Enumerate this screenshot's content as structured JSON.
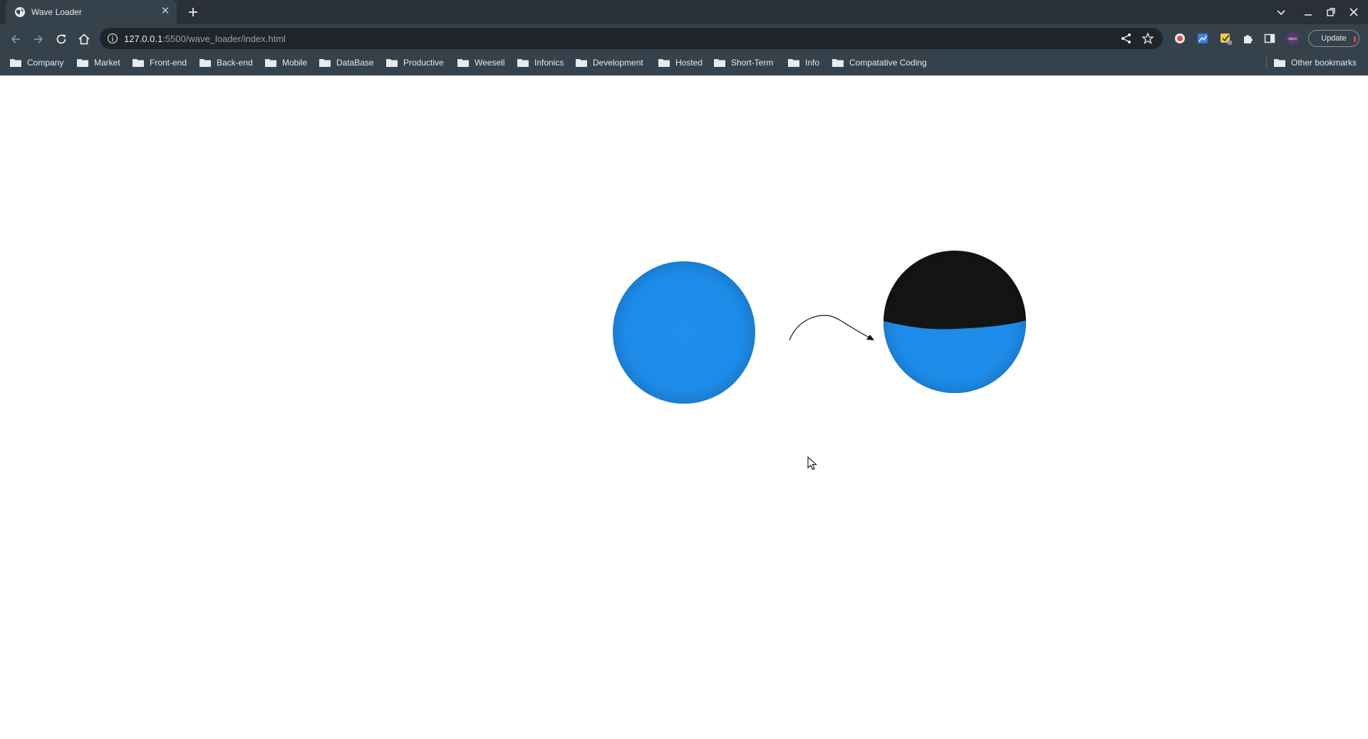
{
  "tab": {
    "title": "Wave Loader"
  },
  "address": {
    "host": "127.0.0.1",
    "path": ":5500/wave_loader/index.html"
  },
  "toolbar": {
    "update_label": "Update",
    "profile_label": "vipin"
  },
  "bookmarks": [
    "Company",
    "Market",
    "Front-end",
    "Back-end",
    "Mobile",
    "DataBase",
    "Productive",
    "Weesell",
    "Infonics",
    "Development",
    "Hosted",
    "Short-Term",
    "Info",
    "Compatative Coding"
  ],
  "other_bookmarks": "Other bookmarks",
  "colors": {
    "water": "#1d8be8",
    "empty_ball": "#131416",
    "chrome_toolbar": "#35414b",
    "chrome_tabstrip": "#2a3037"
  }
}
